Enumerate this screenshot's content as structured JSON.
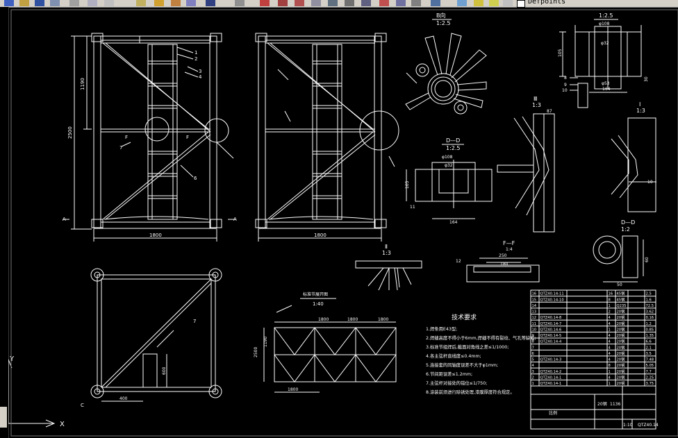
{
  "toolbar": {
    "layer_name": "Defpoints"
  },
  "section_labels": {
    "b": "B向",
    "b_scale": "1:2.5",
    "top_scale": "1:2.5",
    "d": "D—D",
    "d_scale": "1:2.5",
    "iii": "Ⅲ",
    "iii_scale": "1:3",
    "i": "Ⅰ",
    "i_scale": "1:3",
    "ii": "Ⅱ",
    "ii_scale": "1:3",
    "ff": "F—F",
    "ff_scale": "1:4",
    "dd2": "D—D",
    "dd2_scale": "1:2",
    "truss": "标准节展开图",
    "truss_scale": "1:40"
  },
  "dims": {
    "d1800a": "1800",
    "d1800b": "1800",
    "d2500": "2500",
    "d1190": "1190",
    "phi108a": "φ108",
    "phi108b": "φ108",
    "phi32a": "φ32",
    "phi32b": "φ32",
    "phi53": "φ53",
    "d105": "105",
    "d164": "164",
    "d87": "87",
    "d250": "250",
    "d180": "180",
    "d12": "12",
    "d50": "50",
    "d60": "60",
    "d30": "30",
    "d10": "10",
    "d400": "400",
    "d600": "600",
    "d4x1800": "1800",
    "d4x1800b": "1800",
    "d4x1800c": "1800",
    "d1800bot": "1800",
    "d2500s": "2500",
    "d1190s": "1190"
  },
  "callouts": [
    "1",
    "2",
    "3",
    "4",
    "5",
    "6",
    "7",
    "8",
    "9",
    "10",
    "11",
    "12"
  ],
  "letters": {
    "a": "A",
    "f": "F",
    "c": "C"
  },
  "notes": {
    "title": "技术要求",
    "lines": [
      "1.焊条用E43型;",
      "2.焊缝高度不得小于6mm,焊缝不得有裂纹、气孔等缺陷;",
      "3.标准节组焊后,截面对角线之差≤1/1000;",
      "4.各主弦杆直线度≤0.4mm;",
      "5.连接套的同轴度误差不大于φ1mm;",
      "6.节间距误差≤1.2mm;",
      "7.主弦杆对接处的错位≤1/750;",
      "8.涂装前须进行除锈处理,漆膜厚度符合规定。"
    ]
  },
  "bom": {
    "rows": [
      [
        "16",
        "QTZ40.14-11",
        "",
        "16",
        "45钢",
        "",
        "2.5"
      ],
      [
        "15",
        "QTZ40.14-10",
        "",
        "8",
        "45钢",
        "",
        "1.6"
      ],
      [
        "14",
        "",
        "",
        "1",
        "Q235",
        "",
        "72.5"
      ],
      [
        "13",
        "",
        "",
        "2",
        "20钢",
        "",
        "3.62"
      ],
      [
        "12",
        "QTZ40.14-8",
        "",
        "4",
        "20钢",
        "",
        "0.16"
      ],
      [
        "11",
        "QTZ40.14-7",
        "",
        "4",
        "20钢",
        "",
        "1.2"
      ],
      [
        "10",
        "QTZ40.14-6",
        "",
        "1",
        "20钢",
        "",
        "0.85"
      ],
      [
        "9",
        "QTZ40.14-5",
        "",
        "4",
        "20钢",
        "",
        "1.35"
      ],
      [
        "8",
        "QTZ40.14-4",
        "",
        "4",
        "20钢",
        "",
        "6.6"
      ],
      [
        "7",
        "",
        "",
        "4",
        "20钢",
        "",
        "2.1"
      ],
      [
        "6",
        "",
        "",
        "4",
        "20钢",
        "",
        "3.5"
      ],
      [
        "5",
        "QTZ40.14-3",
        "",
        "4",
        "20钢",
        "",
        "7.48"
      ],
      [
        "4",
        "",
        "",
        "8",
        "20钢",
        "",
        "5.05"
      ],
      [
        "3",
        "QTZ40.14-2",
        "",
        "1",
        "20钢",
        "",
        "7.7"
      ],
      [
        "2",
        "QTZ40.14-1",
        "",
        "4",
        "20钢",
        "",
        "2.25"
      ],
      [
        "1",
        "QTZ40.14-1",
        "",
        "1",
        "20钢",
        "",
        "3.75"
      ]
    ],
    "title_block": {
      "material": "20钢",
      "mass": "1136",
      "scale_label": "比例",
      "drawing_no": "QTZ40.14",
      "scale_val": "1:10"
    }
  },
  "ucs": {
    "x": "X",
    "y": "Y"
  }
}
